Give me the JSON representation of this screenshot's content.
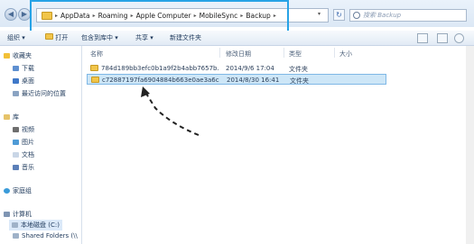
{
  "address": {
    "crumbs": [
      "AppData",
      "Roaming",
      "Apple Computer",
      "MobileSync",
      "Backup"
    ],
    "search_placeholder": "搜索 Backup"
  },
  "toolbar": {
    "organize": "组织 ▾",
    "open": "打开",
    "include": "包含到库中 ▾",
    "share": "共享 ▾",
    "new_folder": "新建文件夹"
  },
  "sidebar": {
    "favorites": "收藏夹",
    "downloads": "下载",
    "desktop": "桌面",
    "recent": "最近访问的位置",
    "libraries": "库",
    "videos": "视频",
    "pictures": "图片",
    "documents": "文档",
    "music": "音乐",
    "homegroup": "家庭组",
    "computer": "计算机",
    "local_disk": "本地磁盘 (C:)",
    "shared": "Shared Folders (\\\\"
  },
  "columns": {
    "name": "名称",
    "date": "修改日期",
    "type": "类型",
    "size": "大小"
  },
  "rows": [
    {
      "name": "784d189bb3efc0b1a9f2b4abb7657b...",
      "date": "2014/9/6 17:04",
      "type": "文件夹"
    },
    {
      "name": "c72887197fa6904884b663e0ae3a6c2...",
      "date": "2014/8/30 16:41",
      "type": "文件夹"
    }
  ]
}
